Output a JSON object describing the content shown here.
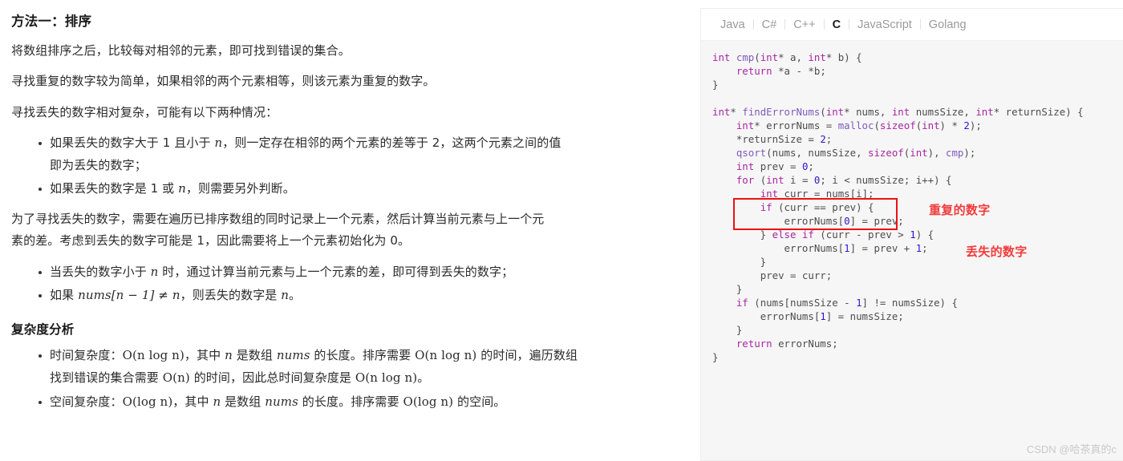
{
  "article": {
    "section_title": "方法一：排序",
    "paragraphs": {
      "p1": "将数组排序之后，比较每对相邻的元素，即可找到错误的集合。",
      "p2": "寻找重复的数字较为简单，如果相邻的两个元素相等，则该元素为重复的数字。",
      "p3": "寻找丢失的数字相对复杂，可能有以下两种情况："
    },
    "list1": {
      "item1_a": "如果丢失的数字大于 1 且小于 ",
      "item1_n": "n",
      "item1_b": "，则一定存在相邻的两个元素的差等于 2，这两个元素之间的值",
      "item1_c": "即为丢失的数字；",
      "item2_a": "如果丢失的数字是 1 或 ",
      "item2_n": "n",
      "item2_b": "，则需要另外判断。"
    },
    "p4_line1": "为了寻找丢失的数字，需要在遍历已排序数组的同时记录上一个元素，然后计算当前元素与上一个元",
    "p4_line2": "素的差。考虑到丢失的数字可能是 1，因此需要将上一个元素初始化为 0。",
    "list2": {
      "item1_a": "当丢失的数字小于 ",
      "item1_n": "n",
      "item1_b": " 时，通过计算当前元素与上一个元素的差，即可得到丢失的数字；",
      "item2_a": "如果 ",
      "item2_expr": "nums[n − 1] ≠ n",
      "item2_b": "，则丢失的数字是 ",
      "item2_n": "n",
      "item2_c": "。"
    },
    "complexity_title": "复杂度分析",
    "list3": {
      "time_label": "时间复杂度：",
      "time_o1": "O(n log n)",
      "time_t1": "，其中 ",
      "time_n1": "n",
      "time_t2": " 是数组 ",
      "time_nums": "nums",
      "time_t3": " 的长度。排序需要 ",
      "time_o2": "O(n log n)",
      "time_t4": " 的时间，遍历数组",
      "time_line2_a": "找到错误的集合需要 ",
      "time_o3": "O(n)",
      "time_line2_b": " 的时间，因此总时间复杂度是 ",
      "time_o4": "O(n log n)",
      "time_line2_c": "。",
      "space_label": "空间复杂度：",
      "space_o1": "O(log n)",
      "space_t1": "，其中 ",
      "space_n1": "n",
      "space_t2": " 是数组 ",
      "space_nums": "nums",
      "space_t3": " 的长度。排序需要 ",
      "space_o2": "O(log n)",
      "space_t4": " 的空间。"
    }
  },
  "code_panel": {
    "tabs": [
      {
        "label": "Java",
        "active": false
      },
      {
        "label": "C#",
        "active": false
      },
      {
        "label": "C++",
        "active": false
      },
      {
        "label": "C",
        "active": true
      },
      {
        "label": "JavaScript",
        "active": false
      },
      {
        "label": "Golang",
        "active": false
      }
    ],
    "language": "C",
    "code_lines": [
      "int cmp(int* a, int* b) {",
      "    return *a - *b;",
      "}",
      "",
      "int* findErrorNums(int* nums, int numsSize, int* returnSize) {",
      "    int* errorNums = malloc(sizeof(int) * 2);",
      "    *returnSize = 2;",
      "    qsort(nums, numsSize, sizeof(int), cmp);",
      "    int prev = 0;",
      "    for (int i = 0; i < numsSize; i++) {",
      "        int curr = nums[i];",
      "        if (curr == prev) {",
      "            errorNums[0] = prev;",
      "        } else if (curr - prev > 1) {",
      "            errorNums[1] = prev + 1;",
      "        }",
      "        prev = curr;",
      "    }",
      "    if (nums[numsSize - 1] != numsSize) {",
      "        errorNums[1] = numsSize;",
      "    }",
      "    return errorNums;",
      "}"
    ],
    "annotations": [
      {
        "text": "重复的数字",
        "color": "#f23b3b"
      },
      {
        "text": "丢失的数字",
        "color": "#f23b3b"
      }
    ],
    "highlight_color": "#ee1111",
    "watermark": "CSDN @哈茶真的c"
  }
}
